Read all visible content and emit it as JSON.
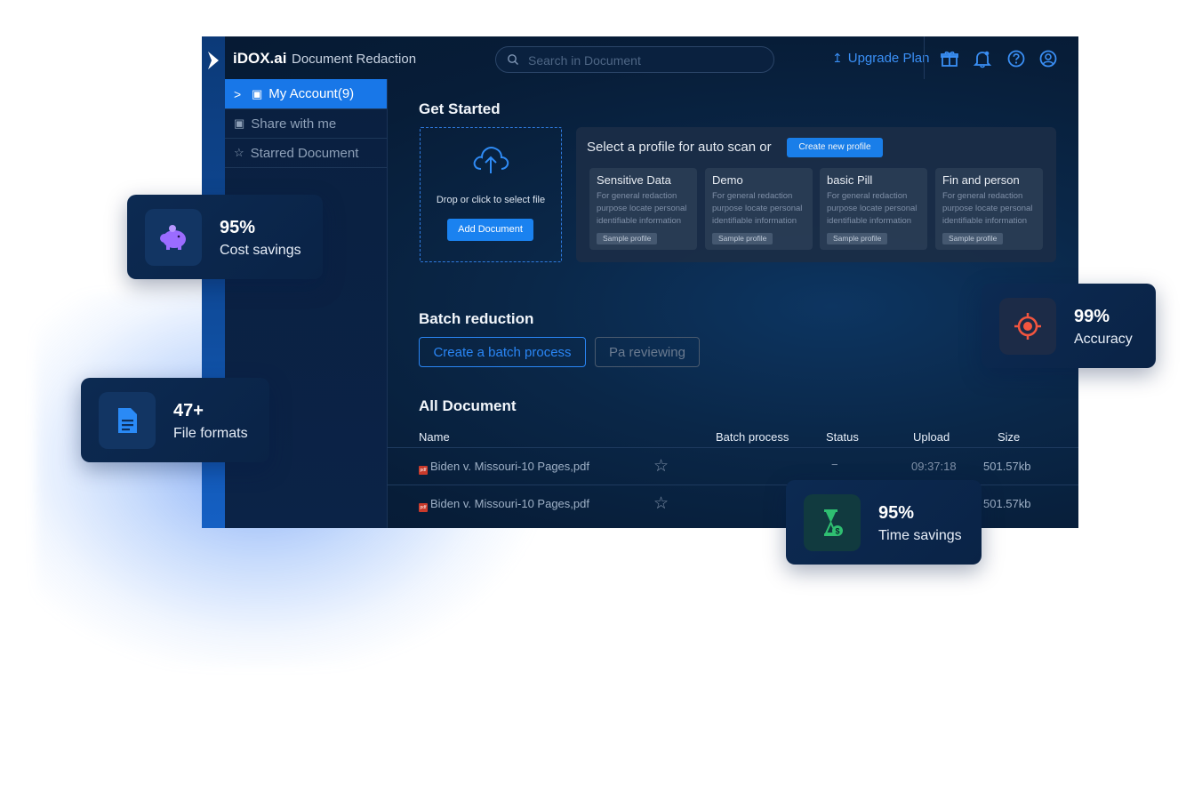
{
  "app": {
    "brand": "iDOX.ai",
    "subtitle": "Document Redaction",
    "search_placeholder": "Search in Document",
    "upgrade_label": "Upgrade Plan"
  },
  "sidebar": {
    "items": [
      {
        "label": "My Account(9)",
        "icon": "folder-icon",
        "active": true
      },
      {
        "label": "Share with me",
        "icon": "folder-icon",
        "active": false
      },
      {
        "label": "Starred Document",
        "icon": "star-icon",
        "active": false
      }
    ]
  },
  "get_started": {
    "title": "Get Started",
    "drop_text": "Drop or click to select file",
    "add_label": "Add Document",
    "profile_prompt": "Select a profile for auto scan or",
    "create_profile_label": "Create new profile",
    "profiles": [
      {
        "name": "Sensitive Data",
        "desc": "For general redaction purpose locate personal identifiable information",
        "badge": "Sample profile"
      },
      {
        "name": "Demo",
        "desc": "For general redaction purpose locate personal identifiable information",
        "badge": "Sample profile"
      },
      {
        "name": "basic Pill",
        "desc": "For general redaction purpose locate personal identifiable information",
        "badge": "Sample profile"
      },
      {
        "name": "Fin and person",
        "desc": "For general redaction purpose locate personal identifiable information",
        "badge": "Sample profile"
      }
    ]
  },
  "batch": {
    "title": "Batch reduction",
    "create_label": "Create a batch process",
    "review_label": "Pa reviewing"
  },
  "documents": {
    "title": "All Document",
    "columns": [
      "Name",
      "Batch process",
      "Status",
      "Upload",
      "Size"
    ],
    "rows": [
      {
        "name": "Biden v. Missouri-10 Pages,pdf",
        "status": "−",
        "upload": "09:37:18",
        "size": "501.57kb"
      },
      {
        "name": "Biden v. Missouri-10 Pages,pdf",
        "status": "",
        "upload": "",
        "size": "501.57kb"
      }
    ]
  },
  "stats": [
    {
      "value": "95%",
      "label": "Cost savings",
      "icon": "piggy-bank-icon",
      "color": "#9b6cff"
    },
    {
      "value": "47+",
      "label": "File formats",
      "icon": "document-icon",
      "color": "#2a8af6"
    },
    {
      "value": "99%",
      "label": "Accuracy",
      "icon": "target-icon",
      "color": "#f2553f"
    },
    {
      "value": "95%",
      "label": "Time savings",
      "icon": "hourglass-dollar-icon",
      "color": "#2fbf71"
    }
  ],
  "colors": {
    "accent": "#1a82f0",
    "bg": "#071d38"
  }
}
